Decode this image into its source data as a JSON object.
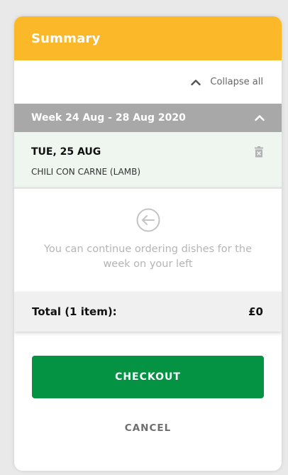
{
  "header": {
    "title": "Summary"
  },
  "collapse": {
    "label": "Collapse all",
    "icon": "chevron-up-icon"
  },
  "week": {
    "title": "Week 24 Aug - 28 Aug 2020",
    "chevron_icon": "chevron-up-icon"
  },
  "days": [
    {
      "title": "TUE, 25 AUG",
      "dish": "CHILI CON CARNE (LAMB)",
      "delete_icon": "trash-icon"
    }
  ],
  "continue": {
    "icon": "circle-left-arrow-icon",
    "text": "You can continue ordering dishes for the week on your left"
  },
  "total": {
    "label": "Total (1 item):",
    "value": "£0"
  },
  "actions": {
    "checkout_label": "CHECKOUT",
    "cancel_label": "CANCEL"
  },
  "colors": {
    "header": "#fbb829",
    "week_header": "#a8a8a8",
    "day_background": "#eef6ef",
    "checkout": "#049243"
  }
}
